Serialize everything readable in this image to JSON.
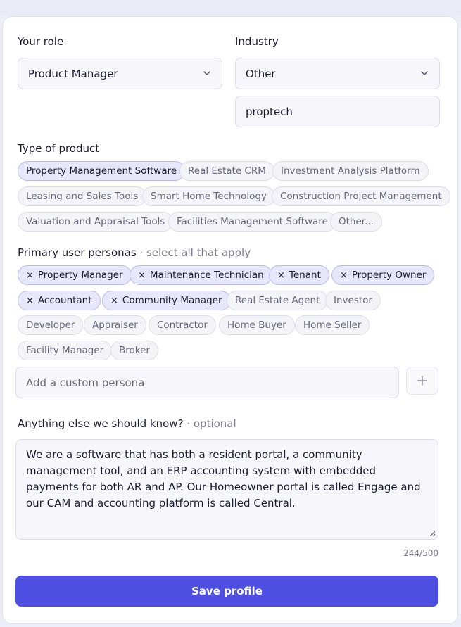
{
  "role": {
    "label": "Your role",
    "value": "Product Manager"
  },
  "industry": {
    "label": "Industry",
    "value": "Other",
    "custom_value": "proptech"
  },
  "product_type": {
    "label": "Type of product",
    "options": [
      {
        "text": "Property Management Software",
        "selected": true
      },
      {
        "text": "Real Estate CRM",
        "selected": false
      },
      {
        "text": "Investment Analysis Platform",
        "selected": false
      },
      {
        "text": "Leasing and Sales Tools",
        "selected": false
      },
      {
        "text": "Smart Home Technology",
        "selected": false
      },
      {
        "text": "Construction Project Management",
        "selected": false
      },
      {
        "text": "Valuation and Appraisal Tools",
        "selected": false
      },
      {
        "text": "Facilities Management Software",
        "selected": false
      },
      {
        "text": "Other...",
        "selected": false
      }
    ]
  },
  "personas": {
    "label": "Primary user personas",
    "hint": "· select all that apply",
    "remove_glyph": "×",
    "options": [
      {
        "text": "Property Manager",
        "selected": true
      },
      {
        "text": "Maintenance Technician",
        "selected": true
      },
      {
        "text": "Tenant",
        "selected": true
      },
      {
        "text": "Property Owner",
        "selected": true
      },
      {
        "text": "Accountant",
        "selected": true
      },
      {
        "text": "Community Manager",
        "selected": true
      },
      {
        "text": "Real Estate Agent",
        "selected": false
      },
      {
        "text": "Investor",
        "selected": false
      },
      {
        "text": "Developer",
        "selected": false
      },
      {
        "text": "Appraiser",
        "selected": false
      },
      {
        "text": "Contractor",
        "selected": false
      },
      {
        "text": "Home Buyer",
        "selected": false
      },
      {
        "text": "Home Seller",
        "selected": false
      },
      {
        "text": "Facility Manager",
        "selected": false
      },
      {
        "text": "Broker",
        "selected": false
      }
    ],
    "custom_placeholder": "Add a custom persona",
    "add_glyph": "+"
  },
  "notes": {
    "label": "Anything else we should know?",
    "hint": "· optional",
    "value": "We are a software that has both a resident portal, a community management tool, and an ERP accounting system with embedded payments for both AR and AP. Our Homeowner portal is called Engage and our CAM and accounting platform is called Central.",
    "counter": "244/500"
  },
  "save_label": "Save profile",
  "colors": {
    "accent": "#4c4fe0",
    "chip_selected_bg": "#e6e7fb",
    "chip_selected_border": "#b9bbef"
  }
}
